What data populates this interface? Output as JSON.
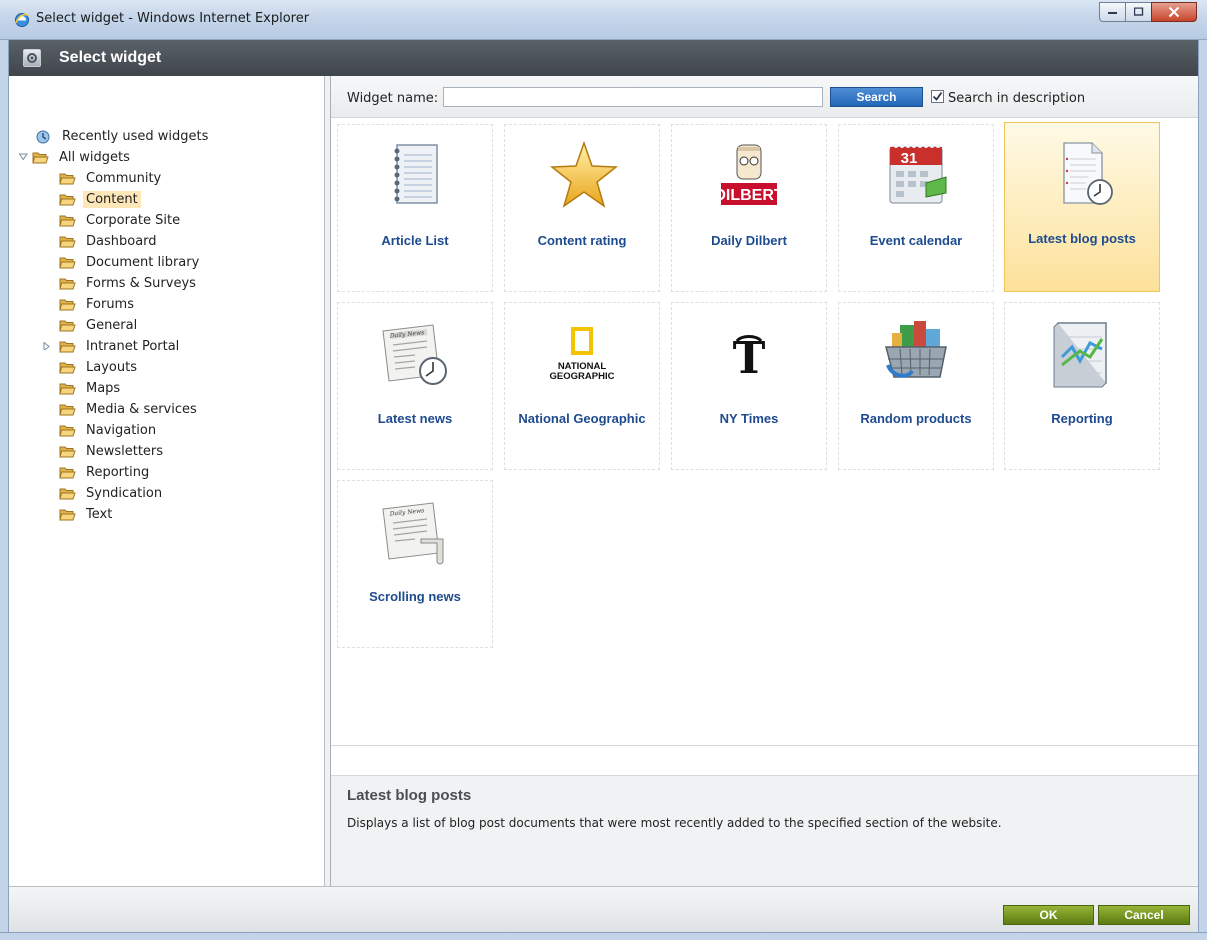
{
  "window": {
    "title": "Select widget - Windows Internet Explorer",
    "controls": [
      "minimize-icon",
      "maximize-icon",
      "close-icon"
    ]
  },
  "header": {
    "title": "Select widget",
    "icon": "widget-gear-icon"
  },
  "tree": {
    "recent": "Recently used widgets",
    "root": "All widgets",
    "items": [
      {
        "label": "Community"
      },
      {
        "label": "Content",
        "selected": true
      },
      {
        "label": "Corporate Site"
      },
      {
        "label": "Dashboard"
      },
      {
        "label": "Document library"
      },
      {
        "label": "Forms & Surveys"
      },
      {
        "label": "Forums"
      },
      {
        "label": "General"
      },
      {
        "label": "Intranet Portal",
        "expandable": true
      },
      {
        "label": "Layouts"
      },
      {
        "label": "Maps"
      },
      {
        "label": "Media & services"
      },
      {
        "label": "Navigation"
      },
      {
        "label": "Newsletters"
      },
      {
        "label": "Reporting"
      },
      {
        "label": "Syndication"
      },
      {
        "label": "Text"
      }
    ]
  },
  "search": {
    "label": "Widget name:",
    "value": "",
    "button": "Search",
    "checkbox_label": "Search in description",
    "checkbox_checked": true
  },
  "widgets": [
    {
      "name": "Article List",
      "icon": "notepad-icon"
    },
    {
      "name": "Content rating",
      "icon": "star-icon"
    },
    {
      "name": "Daily Dilbert",
      "icon": "dilbert-icon",
      "logo_text": "DILBERT"
    },
    {
      "name": "Event calendar",
      "icon": "calendar-icon",
      "logo_text": "31"
    },
    {
      "name": "Latest blog posts",
      "icon": "document-clock-icon",
      "selected": true
    },
    {
      "name": "Latest news",
      "icon": "newspaper-clock-icon",
      "logo_text": "Daily News"
    },
    {
      "name": "National Geographic",
      "icon": "natgeo-icon",
      "logo_text": "NATIONAL GEOGRAPHIC"
    },
    {
      "name": "NY Times",
      "icon": "nytimes-icon",
      "logo_text": "T"
    },
    {
      "name": "Random products",
      "icon": "shopping-basket-icon"
    },
    {
      "name": "Reporting",
      "icon": "chart-icon"
    },
    {
      "name": "Scrolling news",
      "icon": "newspaper-scroll-icon",
      "logo_text": "Daily News"
    }
  ],
  "description": {
    "title": "Latest blog posts",
    "text": "Displays a list of blog post documents that were most recently added to the specified section of the website."
  },
  "footer": {
    "ok": "OK",
    "cancel": "Cancel"
  },
  "colors": {
    "header_bg": "#4a5056",
    "link": "#1e4b8f",
    "selected_tile": "#fce19a",
    "search_button": "#2266b8",
    "ok_button": "#6e8c1c"
  }
}
